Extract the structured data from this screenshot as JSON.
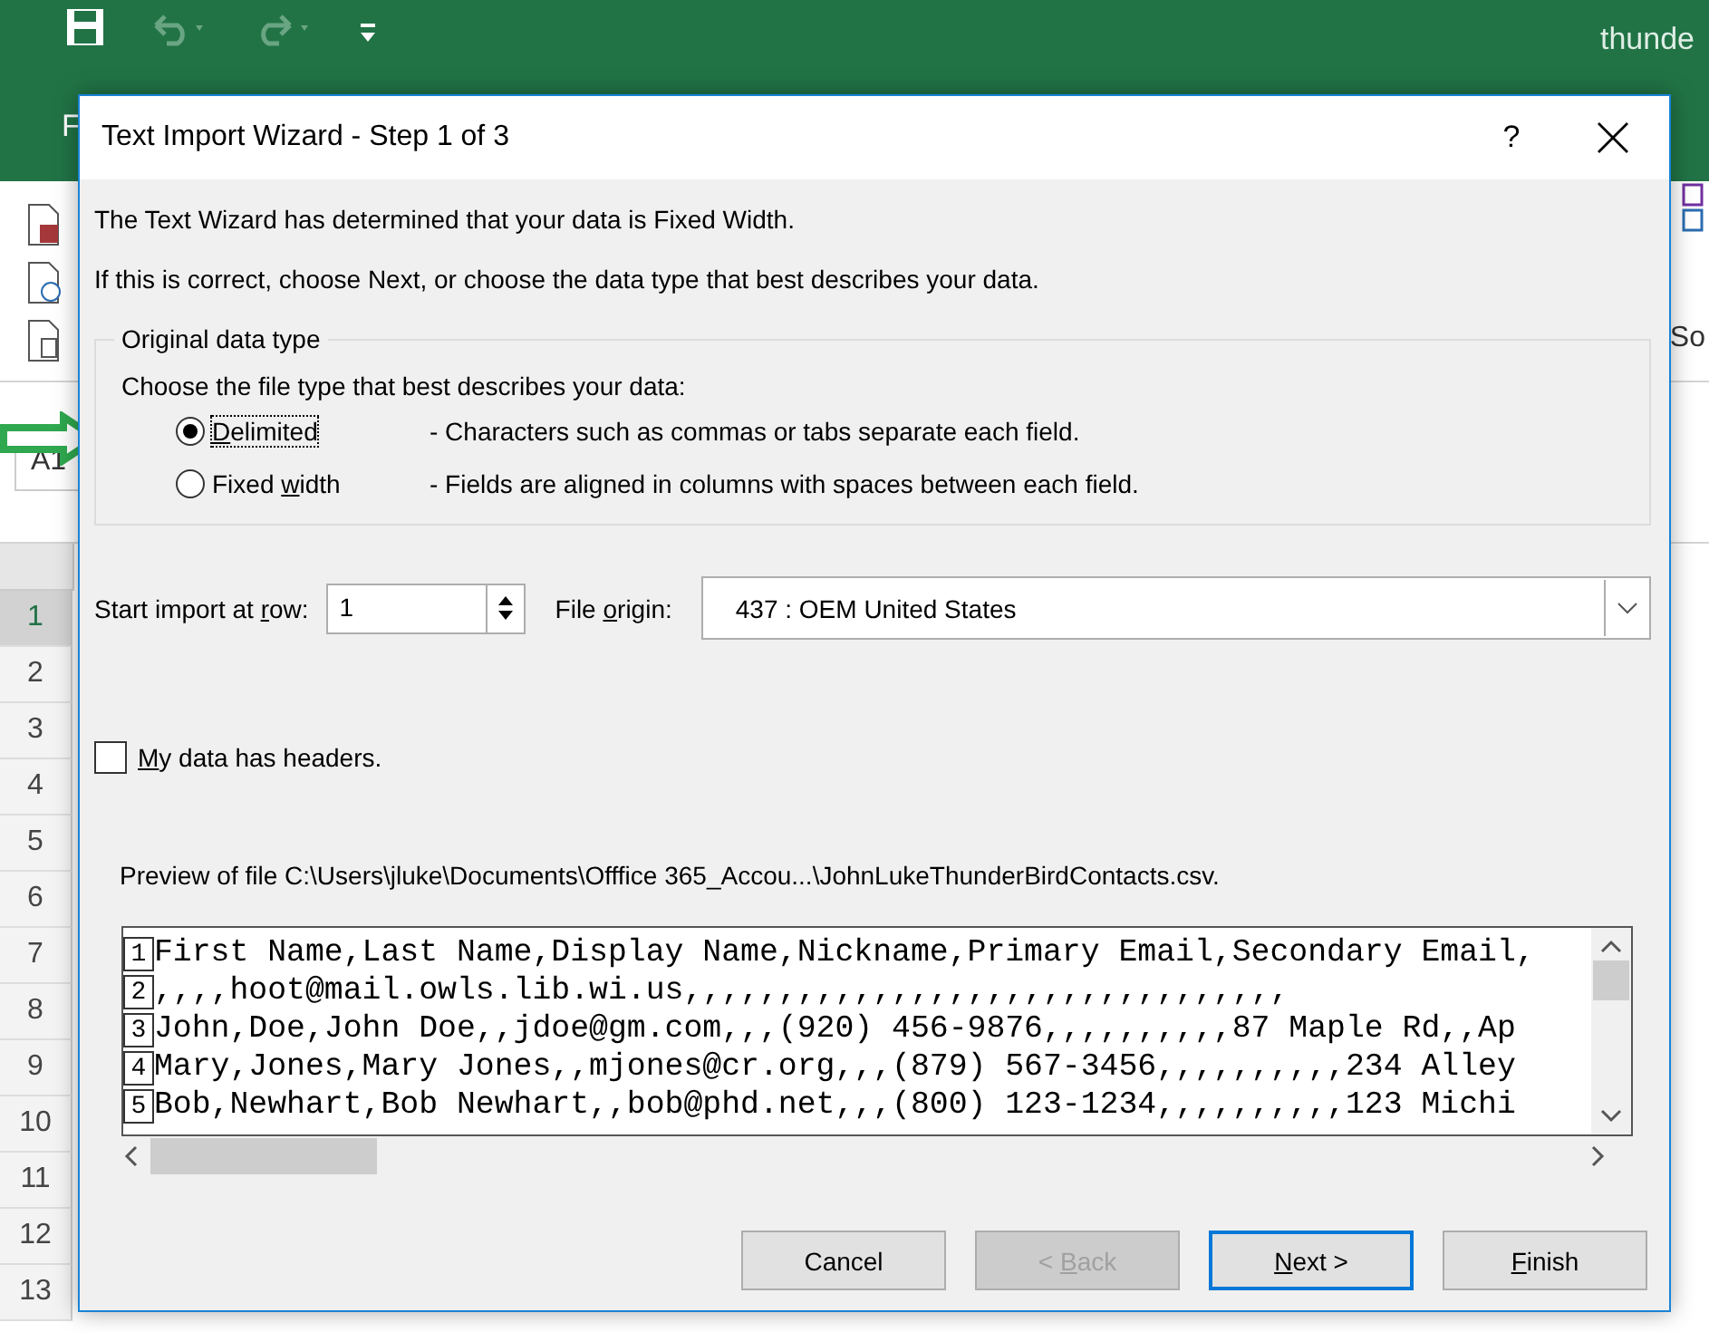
{
  "app": {
    "title": "thunde",
    "tab": "F",
    "name_box": "A1",
    "ribbon_label": "So",
    "row_numbers": [
      "1",
      "2",
      "3",
      "4",
      "5",
      "6",
      "7",
      "8",
      "9",
      "10",
      "11",
      "12",
      "13"
    ]
  },
  "dialog": {
    "title": "Text Import Wizard - Step 1 of 3",
    "help": "?",
    "intro": [
      "The Text Wizard has determined that your data is Fixed Width.",
      "If this is correct, choose Next, or choose the data type that best describes your data."
    ],
    "group": {
      "title": "Original data type",
      "prompt": "Choose the file type that best describes your data:",
      "options": [
        {
          "hotkey": "D",
          "post": "elimited",
          "description": "- Characters such as commas or tabs separate each field.",
          "selected": true,
          "focused": true
        },
        {
          "pre": "Fixed ",
          "hotkey": "w",
          "post": "idth",
          "description": "- Fields are aligned in columns with spaces between each field.",
          "selected": false,
          "focused": false
        }
      ]
    },
    "start_row": {
      "pre": "Start import at ",
      "hotkey": "r",
      "post": "ow:",
      "value": "1"
    },
    "origin": {
      "pre": "File ",
      "hotkey": "o",
      "post": "rigin:",
      "value": "437 : OEM United States"
    },
    "headers": {
      "hotkey": "M",
      "post": "y data has headers.",
      "checked": false
    },
    "preview_label": "Preview of file C:\\Users\\jluke\\Documents\\Offfice 365_Accou...\\JohnLukeThunderBirdContacts.csv.",
    "preview": [
      {
        "number": "1",
        "text": "First Name,Last Name,Display Name,Nickname,Primary Email,Secondary Email,"
      },
      {
        "number": "2",
        "text": ",,,,hoot@mail.owls.lib.wi.us,,,,,,,,,,,,,,,,,,,,,,,,,,,,,,,,"
      },
      {
        "number": "3",
        "text": "John,Doe,John Doe,,jdoe@gm.com,,,(920) 456-9876,,,,,,,,,,87 Maple Rd,,Ap"
      },
      {
        "number": "4",
        "text": "Mary,Jones,Mary Jones,,mjones@cr.org,,,(879) 567-3456,,,,,,,,,,234 Alley"
      },
      {
        "number": "5",
        "text": "Bob,Newhart,Bob Newhart,,bob@phd.net,,,(800) 123-1234,,,,,,,,,,123 Michi"
      }
    ],
    "buttons": [
      {
        "pre": "Cancel",
        "disabled": false,
        "default": false
      },
      {
        "pre": "< ",
        "hotkey": "B",
        "post": "ack",
        "disabled": true,
        "default": false
      },
      {
        "hotkey": "N",
        "post": "ext >",
        "disabled": false,
        "default": true
      },
      {
        "hotkey": "F",
        "post": "inish",
        "disabled": false,
        "default": false
      }
    ]
  }
}
